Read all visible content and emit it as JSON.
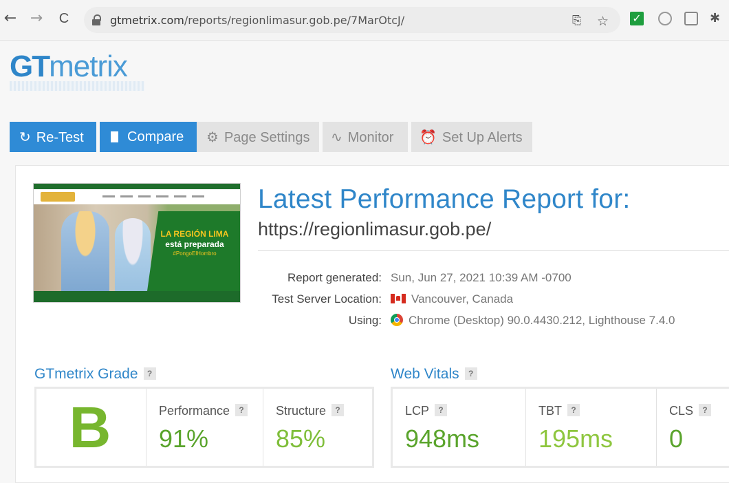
{
  "browser": {
    "back": "←",
    "forward": "→",
    "reload": "C",
    "url_domain": "gtmetrix.com",
    "url_path": "/reports/regionlimasur.gob.pe/7MarOtcJ/",
    "translate_icon": "translate-icon",
    "star_icon": "star-icon",
    "extensions": [
      "checkbox-extension-icon",
      "github-extension-icon",
      "cast-extension-icon",
      "puzzle-extension-icon"
    ]
  },
  "logo": {
    "gt": "GT",
    "metrix": "metrix"
  },
  "toolbar": {
    "retest": "Re-Test",
    "compare": "Compare",
    "page_settings": "Page Settings",
    "monitor": "Monitor",
    "alerts": "Set Up Alerts"
  },
  "report": {
    "title": "Latest Performance Report for:",
    "url": "https://regionlimasur.gob.pe/",
    "generated_label": "Report generated:",
    "generated_value": "Sun, Jun 27, 2021 10:39 AM -0700",
    "location_label": "Test Server Location:",
    "location_value": "Vancouver, Canada",
    "using_label": "Using:",
    "using_value": "Chrome (Desktop) 90.0.4430.212, Lighthouse 7.4.0"
  },
  "thumbnail": {
    "line1": "LA REGIÓN LIMA",
    "line2": "está preparada",
    "line3": "#PongoElHombro"
  },
  "grade": {
    "heading": "GTmetrix Grade",
    "help": "?",
    "letter": "B",
    "performance_label": "Performance",
    "performance_value": "91%",
    "structure_label": "Structure",
    "structure_value": "85%"
  },
  "vitals": {
    "heading": "Web Vitals",
    "help": "?",
    "lcp_label": "LCP",
    "lcp_value": "948ms",
    "tbt_label": "TBT",
    "tbt_value": "195ms",
    "cls_label": "CLS",
    "cls_value": "0"
  },
  "colors": {
    "brand_blue": "#2f86c9",
    "grade_green": "#77b62e",
    "good_green": "#5aa42c",
    "ok_green": "#8ec63f"
  }
}
